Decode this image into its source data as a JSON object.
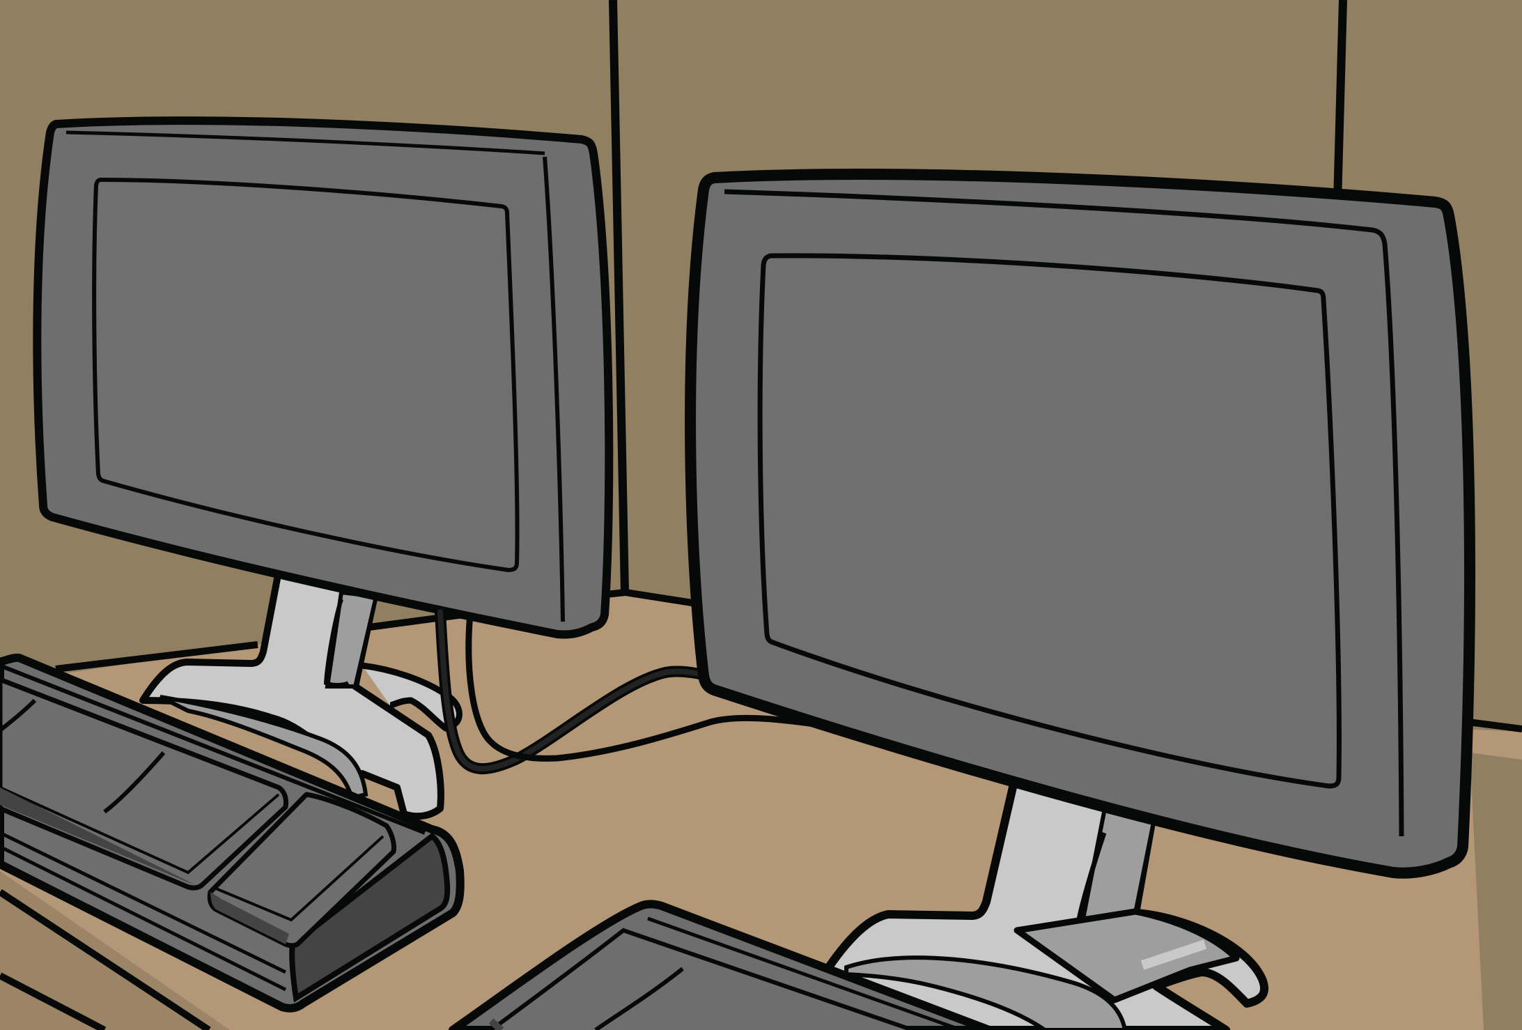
{
  "scene": {
    "description_visible_text": [],
    "colors": {
      "wall": "#917f61",
      "desk": "#b39777",
      "desk_shadow": "#9c8566",
      "outline": "#070808",
      "monitor_bezel": "#6e6e6e",
      "monitor_side": "#474747",
      "monitor_screen": "#6f6f6f",
      "stand_light": "#c9c9c9",
      "stand_mid": "#9e9e9e",
      "keyboard_top": "#6e6e6e",
      "keyboard_dark": "#444444",
      "cable": "#222222"
    },
    "objects": [
      "left-monitor",
      "right-monitor",
      "left-keyboard",
      "right-keyboard",
      "monitor-cable",
      "cubicle-wall"
    ]
  }
}
